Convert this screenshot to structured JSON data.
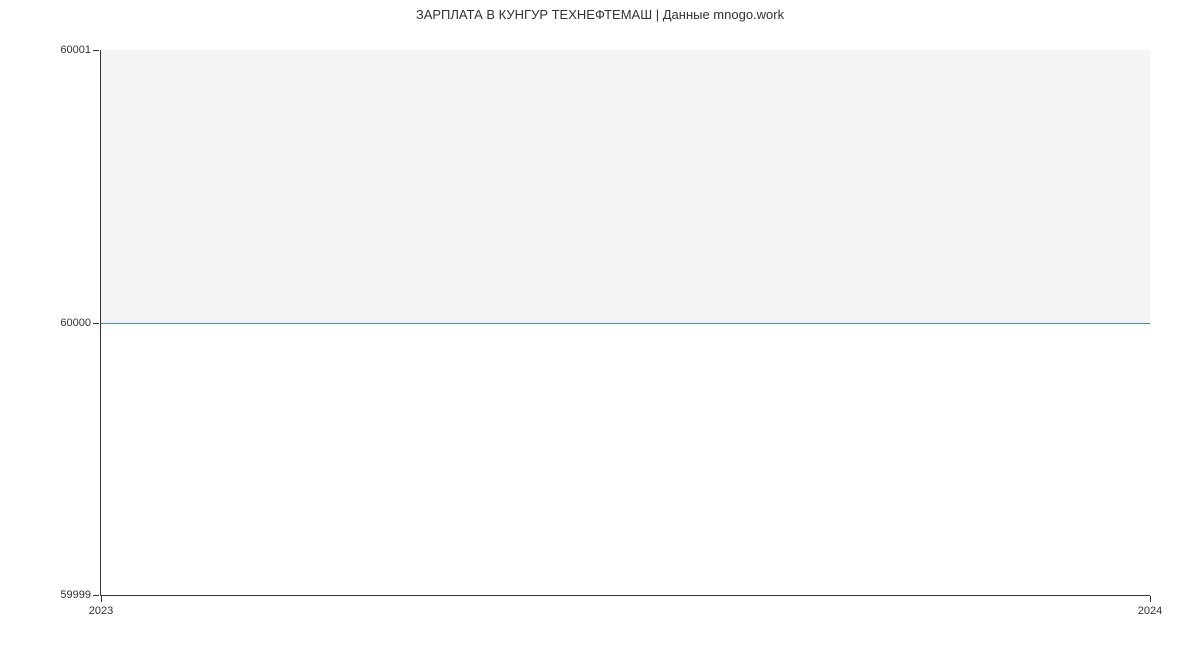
{
  "chart_data": {
    "type": "line",
    "title": "ЗАРПЛАТА В КУНГУР ТЕХНЕФТЕМАШ | Данные mnogo.work",
    "x": [
      2023,
      2024
    ],
    "values": [
      60000,
      60000
    ],
    "xlabel": "",
    "ylabel": "",
    "x_ticks": [
      "2023",
      "2024"
    ],
    "y_ticks": [
      "59999",
      "60000",
      "60001"
    ],
    "xlim": [
      2023,
      2024
    ],
    "ylim": [
      59999,
      60001
    ]
  }
}
